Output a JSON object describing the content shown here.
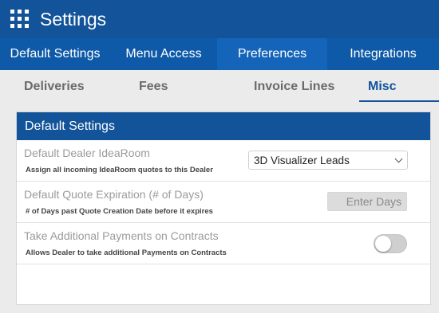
{
  "header": {
    "title": "Settings",
    "icon": "apps-grid-icon"
  },
  "main_tabs": [
    {
      "label": "Default Settings"
    },
    {
      "label": "Menu Access"
    },
    {
      "label": "Preferences",
      "active": true
    },
    {
      "label": "Integrations"
    }
  ],
  "sub_tabs": [
    {
      "label": "Deliveries"
    },
    {
      "label": "Fees"
    },
    {
      "label": "Invoice Lines"
    },
    {
      "label": "Misc",
      "active": true
    }
  ],
  "panel": {
    "title": "Default Settings",
    "rows": [
      {
        "label": "Default Dealer IdeaRoom",
        "help": "Assign all incoming IdeaRoom quotes to this Dealer",
        "control": "select",
        "value": "3D Visualizer Leads"
      },
      {
        "label": "Default Quote Expiration (# of Days)",
        "help": "# of Days past Quote Creation Date before it expires",
        "control": "input",
        "value": "",
        "placeholder": "Enter Days"
      },
      {
        "label": "Take Additional Payments on Contracts",
        "help": "Allows Dealer to take additional Payments on Contracts",
        "control": "toggle",
        "checked": false
      }
    ]
  },
  "colors": {
    "header_bg": "#125399",
    "tab_bar_bg": "#0f5aa8",
    "active_tab_bg": "#1465b9",
    "active_subtab_text": "#125399",
    "page_bg": "#ebebeb"
  }
}
